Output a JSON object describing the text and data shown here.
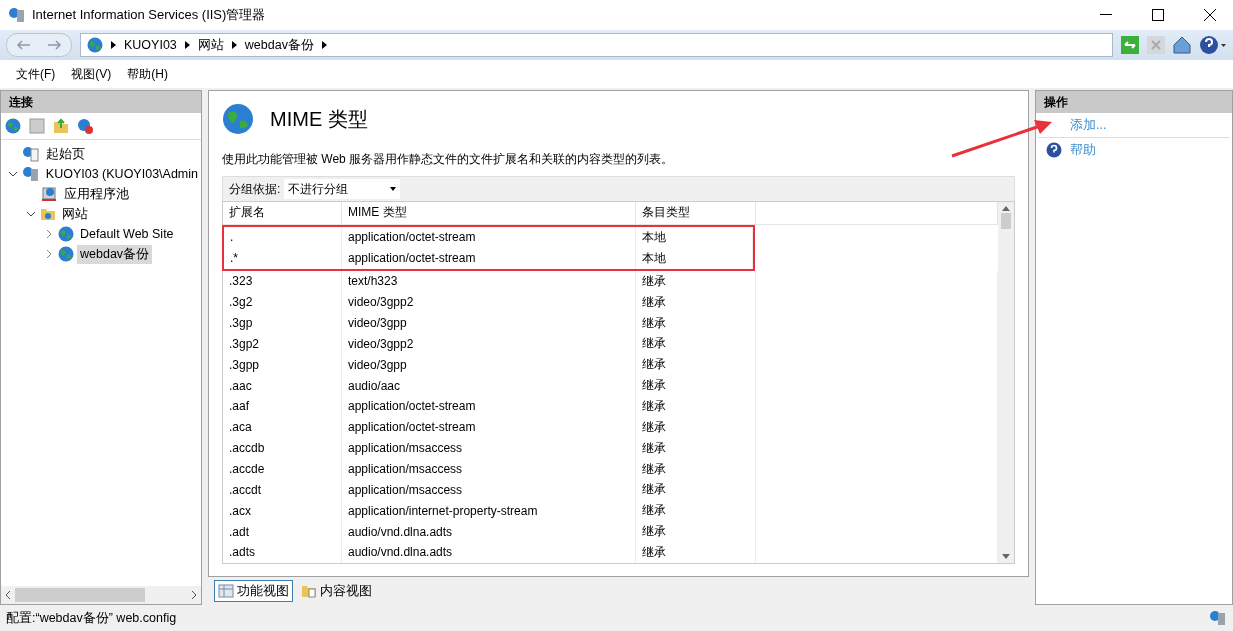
{
  "window": {
    "title": "Internet Information Services (IIS)管理器"
  },
  "address_bar": {
    "crumbs": [
      "KUOYI03",
      "网站",
      "webdav备份"
    ]
  },
  "menu": [
    "文件(F)",
    "视图(V)",
    "帮助(H)"
  ],
  "connections": {
    "title": "连接",
    "tree": [
      {
        "label": "起始页",
        "kind": "start",
        "selected": false
      },
      {
        "label": "KUOYI03 (KUOYI03\\Admin",
        "kind": "server",
        "selected": false,
        "expanded": true,
        "children": [
          {
            "label": "应用程序池",
            "kind": "pool",
            "selected": false
          },
          {
            "label": "网站",
            "kind": "folder",
            "selected": false,
            "expanded": true,
            "children": [
              {
                "label": "Default Web Site",
                "kind": "site",
                "selected": false,
                "expanded": false
              },
              {
                "label": "webdav备份",
                "kind": "site",
                "selected": true,
                "expanded": false
              }
            ]
          }
        ]
      }
    ]
  },
  "feature": {
    "title": "MIME 类型",
    "description": "使用此功能管理被 Web 服务器用作静态文件的文件扩展名和关联的内容类型的列表。",
    "group_by": {
      "label": "分组依据:",
      "value": "不进行分组"
    },
    "table": {
      "columns": [
        "扩展名",
        "MIME 类型",
        "条目类型"
      ],
      "rows": [
        {
          "cells": [
            ".",
            "application/octet-stream",
            "本地"
          ],
          "highlighted": true
        },
        {
          "cells": [
            ".*",
            "application/octet-stream",
            "本地"
          ],
          "highlighted": true
        },
        {
          "cells": [
            ".323",
            "text/h323",
            "继承"
          ],
          "highlighted": false
        },
        {
          "cells": [
            ".3g2",
            "video/3gpp2",
            "继承"
          ],
          "highlighted": false
        },
        {
          "cells": [
            ".3gp",
            "video/3gpp",
            "继承"
          ],
          "highlighted": false
        },
        {
          "cells": [
            ".3gp2",
            "video/3gpp2",
            "继承"
          ],
          "highlighted": false
        },
        {
          "cells": [
            ".3gpp",
            "video/3gpp",
            "继承"
          ],
          "highlighted": false
        },
        {
          "cells": [
            ".aac",
            "audio/aac",
            "继承"
          ],
          "highlighted": false
        },
        {
          "cells": [
            ".aaf",
            "application/octet-stream",
            "继承"
          ],
          "highlighted": false
        },
        {
          "cells": [
            ".aca",
            "application/octet-stream",
            "继承"
          ],
          "highlighted": false
        },
        {
          "cells": [
            ".accdb",
            "application/msaccess",
            "继承"
          ],
          "highlighted": false
        },
        {
          "cells": [
            ".accde",
            "application/msaccess",
            "继承"
          ],
          "highlighted": false
        },
        {
          "cells": [
            ".accdt",
            "application/msaccess",
            "继承"
          ],
          "highlighted": false
        },
        {
          "cells": [
            ".acx",
            "application/internet-property-stream",
            "继承"
          ],
          "highlighted": false
        },
        {
          "cells": [
            ".adt",
            "audio/vnd.dlna.adts",
            "继承"
          ],
          "highlighted": false
        },
        {
          "cells": [
            ".adts",
            "audio/vnd.dlna.adts",
            "继承"
          ],
          "highlighted": false
        }
      ]
    },
    "view_tabs": [
      {
        "label": "功能视图",
        "selected": true
      },
      {
        "label": "内容视图",
        "selected": false
      }
    ]
  },
  "actions": {
    "title": "操作",
    "items": [
      {
        "label": "添加...",
        "kind": "add"
      },
      {
        "label": "帮助",
        "kind": "help"
      }
    ]
  },
  "status_bar": {
    "text": "配置:“webdav备份” web.config"
  }
}
